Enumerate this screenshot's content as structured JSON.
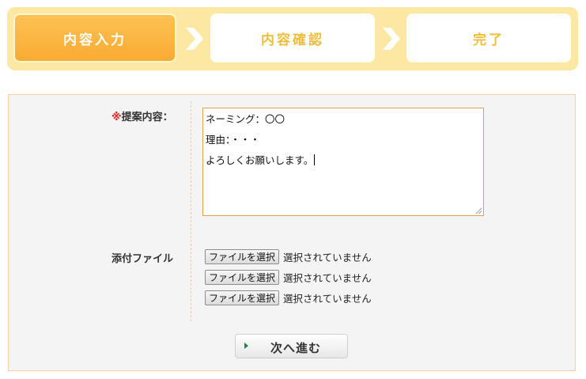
{
  "steps": [
    {
      "label": "内容入力",
      "state": "active"
    },
    {
      "label": "内容確認",
      "state": "inactive"
    },
    {
      "label": "完了",
      "state": "inactive"
    }
  ],
  "form": {
    "proposal": {
      "required_mark": "※",
      "label": "提案内容：",
      "lines": [
        "ネーミング：〇〇",
        "理由：・・・",
        "よろしくお願いします。"
      ]
    },
    "attachments": {
      "label": "添付ファイル",
      "files": [
        {
          "button": "ファイルを選択",
          "status": "選択されていません"
        },
        {
          "button": "ファイルを選択",
          "status": "選択されていません"
        },
        {
          "button": "ファイルを選択",
          "status": "選択されていません"
        }
      ]
    },
    "next_button": "次へ進む"
  },
  "colors": {
    "active_step": "#f9ab33",
    "inactive_step_text": "#efbe39",
    "stepbar_bg": "#fde8a3",
    "required": "#d9261c",
    "textarea_border": "#e2a445",
    "arrow_icon": "#1a8a4a"
  },
  "icons": {
    "step_separator": "chevron-right-icon",
    "next_arrow": "triangle-right-icon",
    "resize": "resize-grip-icon"
  }
}
